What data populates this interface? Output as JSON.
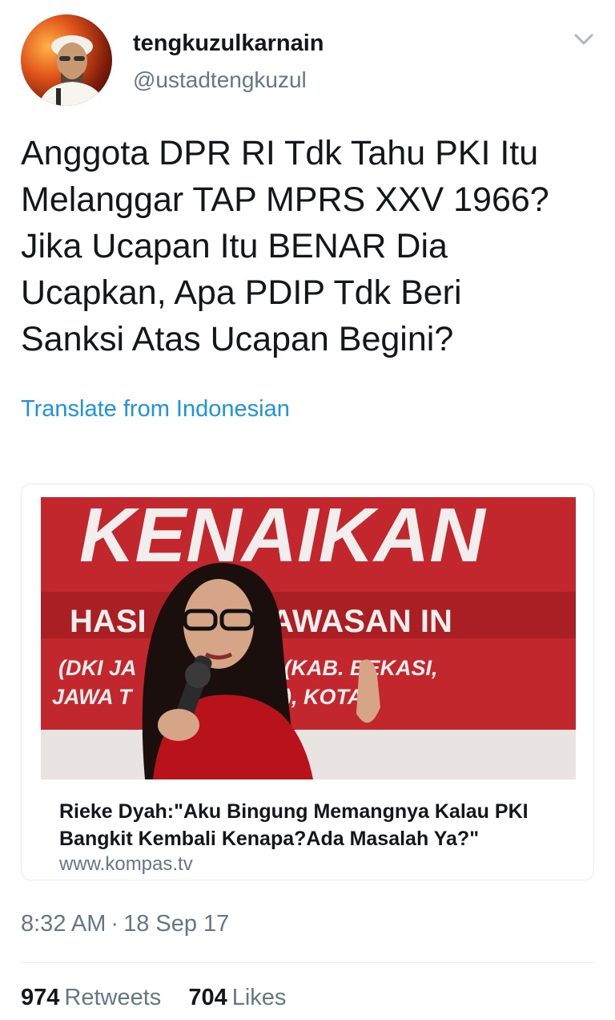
{
  "user": {
    "display_name": "tengkuzulkarnain",
    "handle": "@ustadtengkuzul"
  },
  "tweet": {
    "lines": [
      "Anggota DPR RI Tdk Tahu PKI Itu",
      "Melanggar TAP MPRS XXV 1966?",
      "Jika Ucapan Itu BENAR Dia",
      "Ucapkan, Apa PDIP Tdk Beri",
      "Sanksi Atas Ucapan Begini?"
    ],
    "translate_label": "Translate from Indonesian"
  },
  "card": {
    "image_text": {
      "banner_top": "KENAIKAN",
      "banner_mid": "HASI    EI 7 KAWASAN IN",
      "banner_low1": "(DKI JA        A BARAT (KAB. BEKASI,",
      "banner_low2": "JAWA T         IDOARJO), KOTA"
    },
    "title_lines": [
      "Rieke Dyah:\"Aku Bingung Memangnya Kalau PKI",
      "Bangkit Kembali Kenapa?Ada Masalah Ya?\""
    ],
    "domain": "www.kompas.tv"
  },
  "meta": {
    "time": "8:32 AM",
    "separator": "·",
    "date": "18 Sep 17"
  },
  "stats": {
    "retweets_count": "974",
    "retweets_label": "Retweets",
    "likes_count": "704",
    "likes_label": "Likes"
  },
  "colors": {
    "link": "#1b95e0",
    "secondary_text": "#657786",
    "primary_text": "#14171a",
    "banner_red": "#c2272d"
  },
  "icons": {
    "menu": "chevron-down-icon",
    "avatar": "user-avatar"
  }
}
